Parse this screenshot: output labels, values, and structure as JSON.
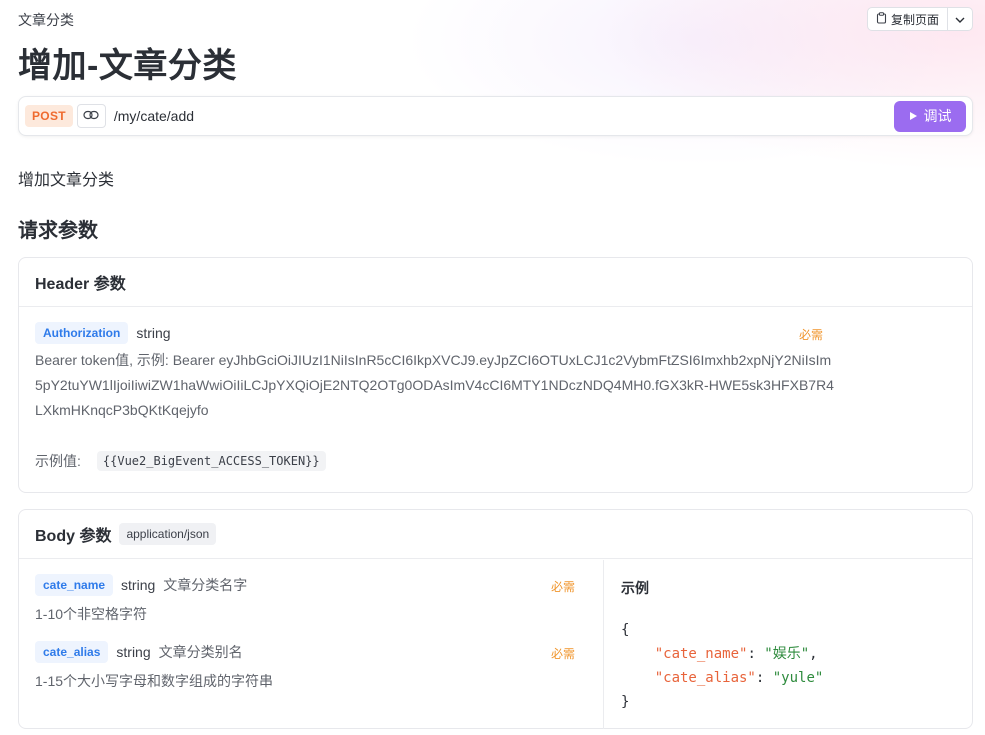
{
  "breadcrumb": "文章分类",
  "toolbar": {
    "copy_label": "复制页面"
  },
  "page_title": "增加-文章分类",
  "request": {
    "method": "POST",
    "path": "/my/cate/add",
    "debug_label": "调试"
  },
  "description": "增加文章分类",
  "section_title": "请求参数",
  "header_params": {
    "title": "Header 参数",
    "items": [
      {
        "name": "Authorization",
        "type": "string",
        "required_label": "必需",
        "description": "Bearer token值, 示例: Bearer eyJhbGciOiJIUzI1NiIsInR5cCI6IkpXVCJ9.eyJpZCI6OTUxLCJ1c2VybmFtZSI6Imxhb2xpNjY2NiIsIm5pY2tuYW1lIjoiIiwiZW1haWwiOiIiLCJpYXQiOjE2NTQ2OTg0ODAsImV4cCI6MTY1NDczNDQ4MH0.fGX3kR-HWE5sk3HFXB7R4LXkmHKnqcP3bQKtKqejyfo",
        "example_label": "示例值:",
        "example_value": "{{Vue2_BigEvent_ACCESS_TOKEN}}"
      }
    ]
  },
  "body_params": {
    "title": "Body 参数",
    "content_type": "application/json",
    "items": [
      {
        "name": "cate_name",
        "type": "string",
        "title": "文章分类名字",
        "required_label": "必需",
        "description": "1-10个非空格字符"
      },
      {
        "name": "cate_alias",
        "type": "string",
        "title": "文章分类别名",
        "required_label": "必需",
        "description": "1-15个大小写字母和数字组成的字符串"
      }
    ],
    "example": {
      "title": "示例",
      "open": "{",
      "close": "}",
      "lines": [
        {
          "key": "\"cate_name\"",
          "value": "\"娱乐\"",
          "sep": ": ",
          "trail": ","
        },
        {
          "key": "\"cate_alias\"",
          "value": "\"yule\"",
          "sep": ": ",
          "trail": ""
        }
      ]
    }
  },
  "colors": {
    "accent": "#9b6cf0",
    "method": "#ef6b2f",
    "param": "#2f7bea",
    "required": "#f0962e"
  }
}
